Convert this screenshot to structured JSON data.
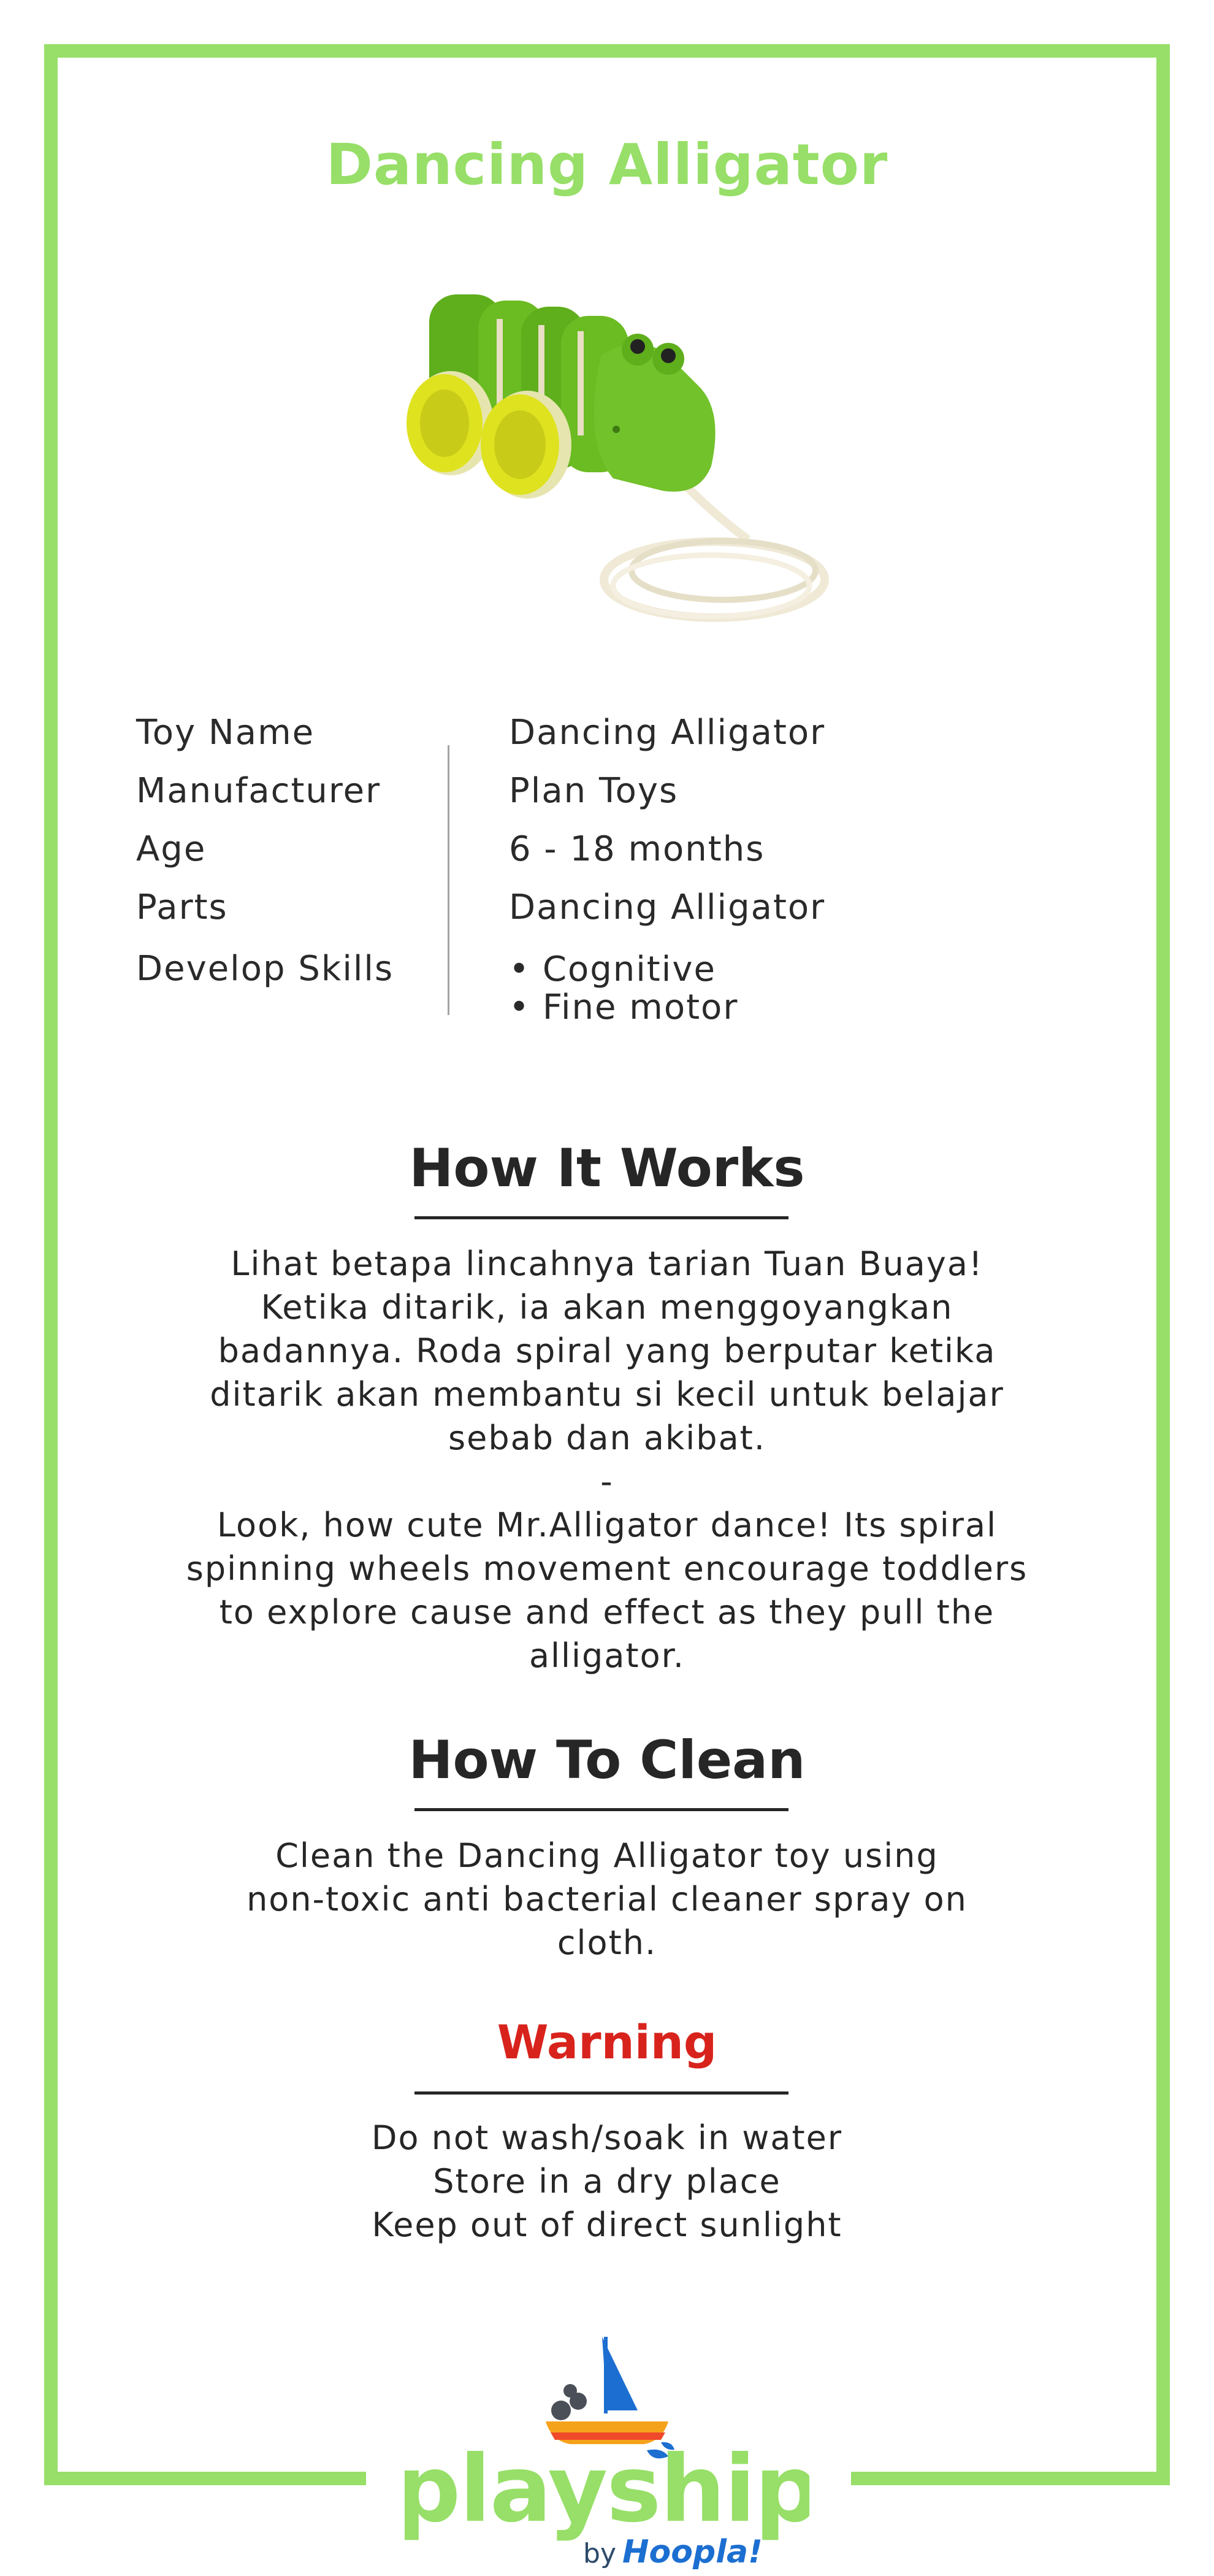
{
  "title": "Dancing Alligator",
  "specs": {
    "rows": [
      {
        "label": "Toy Name",
        "value": "Dancing Alligator"
      },
      {
        "label": "Manufacturer",
        "value": "Plan Toys"
      },
      {
        "label": "Age",
        "value": "6 - 18 months"
      },
      {
        "label": "Parts",
        "value": "Dancing Alligator"
      }
    ],
    "skills_label": "Develop Skills",
    "skills": [
      "Cognitive",
      "Fine motor"
    ]
  },
  "how_it_works": {
    "title": "How It Works",
    "text_id": "Lihat betapa lincahnya tarian Tuan Buaya! Ketika ditarik, ia akan menggoyangkan badannya. Roda spiral yang berputar ketika ditarik akan membantu si kecil untuk belajar sebab dan akibat.",
    "separator": "-",
    "text_en": "Look, how cute Mr.Alligator dance! Its spiral spinning wheels movement encourage toddlers to explore cause and effect as they pull the alligator."
  },
  "how_to_clean": {
    "title": "How To Clean",
    "text": "Clean the Dancing Alligator toy using non-toxic anti bacterial cleaner spray on cloth."
  },
  "warning": {
    "title": "Warning",
    "items": [
      "Do not wash/soak in water",
      "Store in a dry place",
      "Keep out of direct sunlight"
    ]
  },
  "logo": {
    "brand": "playship",
    "by": "by",
    "partner": "Hoopla!"
  },
  "colors": {
    "accent_green": "#97df68",
    "warning_red": "#d8231c",
    "partner_blue": "#1c6fd1"
  }
}
